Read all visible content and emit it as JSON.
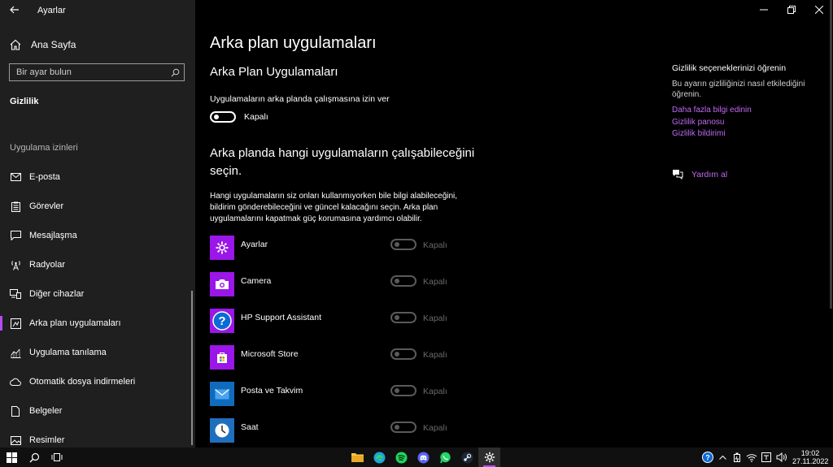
{
  "window": {
    "title": "Ayarlar"
  },
  "sidebar": {
    "home_label": "Ana Sayfa",
    "search_placeholder": "Bir ayar bulun",
    "section_title": "Gizlilik",
    "group_label": "Uygulama izinleri",
    "items": [
      {
        "label": "E-posta",
        "icon": "mail-icon"
      },
      {
        "label": "Görevler",
        "icon": "clipboard-icon"
      },
      {
        "label": "Mesajlaşma",
        "icon": "message-icon"
      },
      {
        "label": "Radyolar",
        "icon": "radio-tower-icon"
      },
      {
        "label": "Diğer cihazlar",
        "icon": "devices-icon"
      },
      {
        "label": "Arka plan uygulamaları",
        "icon": "background-apps-icon",
        "active": true
      },
      {
        "label": "Uygulama tanılama",
        "icon": "diagnostics-icon"
      },
      {
        "label": "Otomatik dosya indirmeleri",
        "icon": "cloud-icon"
      },
      {
        "label": "Belgeler",
        "icon": "document-icon"
      },
      {
        "label": "Resimler",
        "icon": "image-icon"
      }
    ]
  },
  "main": {
    "page_title": "Arka plan uygulamaları",
    "subtitle": "Arka Plan Uygulamaları",
    "toggle_label": "Uygulamaların arka planda çalışmasına izin ver",
    "toggle_state": "Kapalı",
    "heading": "Arka planda hangi uygulamaların çalışabileceğini seçin.",
    "description": "Hangi uygulamaların siz onları kullanmıyorken bile bilgi alabileceğini, bildirim gönderebileceğini ve güncel kalacağını seçin. Arka plan uygulamalarını kapatmak güç korumasına yardımcı olabilir.",
    "apps": [
      {
        "name": "Ayarlar",
        "state": "Kapalı",
        "icon": "gear-icon",
        "color": "#9b16e8"
      },
      {
        "name": "Camera",
        "state": "Kapalı",
        "icon": "camera-icon",
        "color": "#9b16e8"
      },
      {
        "name": "HP Support Assistant",
        "state": "Kapalı",
        "icon": "question-icon",
        "color": "#0a6ad6"
      },
      {
        "name": "Microsoft Store",
        "state": "Kapalı",
        "icon": "store-icon",
        "color": "#9b16e8"
      },
      {
        "name": "Posta ve Takvim",
        "state": "Kapalı",
        "icon": "mail-icon",
        "color": "#0f6cbd"
      },
      {
        "name": "Saat",
        "state": "Kapalı",
        "icon": "clock-icon",
        "color": "#1f6fbf"
      }
    ]
  },
  "right_panel": {
    "heading": "Gizlilik seçeneklerinizi öğrenin",
    "text": "Bu ayarın gizliliğinizi nasıl etkilediğini öğrenin.",
    "links": [
      "Daha fazla bilgi edinin",
      "Gizlilik panosu",
      "Gizlilik bildirimi"
    ],
    "help_label": "Yardım al"
  },
  "taskbar": {
    "time": "19:02",
    "date": "27.11.2022"
  },
  "colors": {
    "accent": "#b44df0",
    "link": "#c169f2"
  }
}
